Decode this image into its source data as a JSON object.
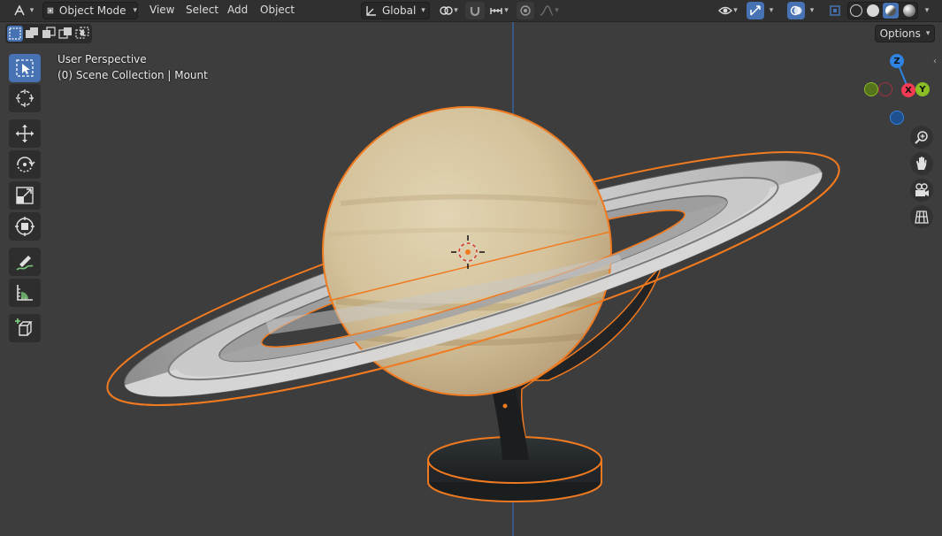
{
  "header": {
    "mode_label": "Object Mode",
    "menu": [
      "View",
      "Select",
      "Add",
      "Object"
    ],
    "orientation_label": "Global"
  },
  "toolbar_right": {
    "options_label": "Options"
  },
  "viewport": {
    "perspective_label": "User Perspective",
    "collection_label": "(0) Scene Collection | Mount"
  },
  "gizmo": {
    "x_label": "X",
    "y_label": "Y",
    "z_label": "Z",
    "x_color": "#f53a54",
    "y_color": "#8bbe24",
    "z_color": "#2f83e3"
  },
  "colors": {
    "accent": "#4772b3",
    "selection_outline": "#f07a20",
    "header_bg": "#303030",
    "viewport_bg": "#3d3d3d"
  },
  "icons": {
    "tools": [
      "select-box-icon",
      "cursor-icon",
      "move-icon",
      "rotate-icon",
      "scale-icon",
      "transform-icon",
      "annotate-icon",
      "measure-icon",
      "add-cube-icon"
    ],
    "nav": [
      "zoom-icon",
      "hand-pan-icon",
      "camera-icon",
      "grid-ortho-icon"
    ]
  }
}
